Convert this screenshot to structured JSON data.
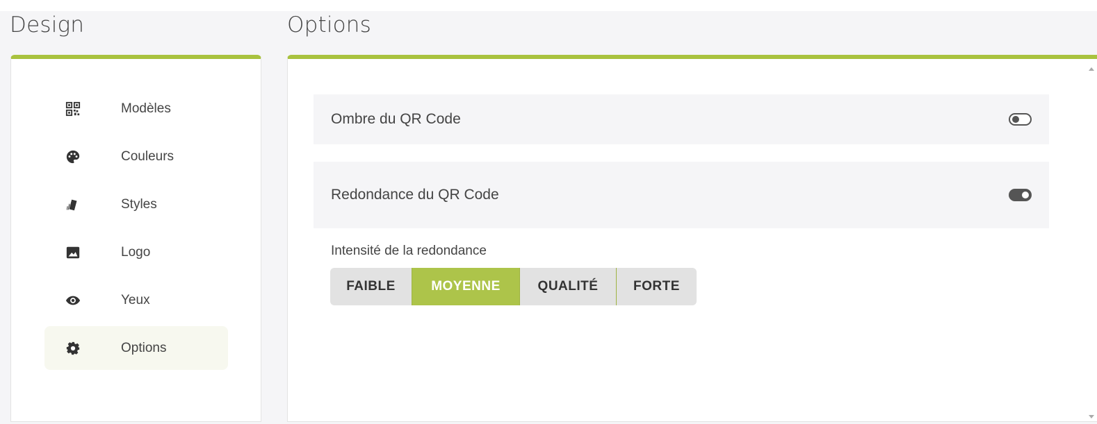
{
  "design": {
    "title": "Design",
    "nav": [
      {
        "label": "Modèles",
        "icon": "qr-code-icon"
      },
      {
        "label": "Couleurs",
        "icon": "palette-icon"
      },
      {
        "label": "Styles",
        "icon": "swatch-book-icon"
      },
      {
        "label": "Logo",
        "icon": "image-icon"
      },
      {
        "label": "Yeux",
        "icon": "eye-icon"
      },
      {
        "label": "Options",
        "icon": "gear-icon",
        "active": true
      }
    ]
  },
  "options": {
    "title": "Options",
    "shadow": {
      "label": "Ombre du QR Code",
      "enabled": false
    },
    "redundancy": {
      "label": "Redondance du QR Code",
      "enabled": true
    },
    "intensity": {
      "label": "Intensité de la redondance",
      "choices": [
        "FAIBLE",
        "MOYENNE",
        "QUALITÉ",
        "FORTE"
      ],
      "selected": "MOYENNE"
    }
  },
  "colors": {
    "accent": "#a9c23f",
    "active_segment": "#adc44a",
    "active_nav_bg": "#f7f8ef"
  }
}
